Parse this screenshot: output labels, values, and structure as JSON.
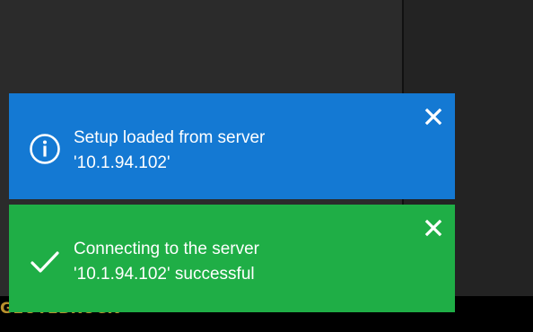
{
  "background": {
    "brand_logo_text": "GEUTEBRÜCK",
    "colors": {
      "panel_left": "#2b2b2b",
      "panel_right": "#232323",
      "bottom_bar": "#000000",
      "logo": "#b8902d"
    }
  },
  "notifications": [
    {
      "type": "info",
      "icon": "info-circle-icon",
      "color": "#1479d3",
      "line1": "Setup loaded from server",
      "line2": "'10.1.94.102'",
      "close_icon": "close-icon"
    },
    {
      "type": "success",
      "icon": "checkmark-icon",
      "color": "#1fae46",
      "line1": "Connecting to the server",
      "line2": "'10.1.94.102' successful",
      "close_icon": "close-icon"
    }
  ]
}
